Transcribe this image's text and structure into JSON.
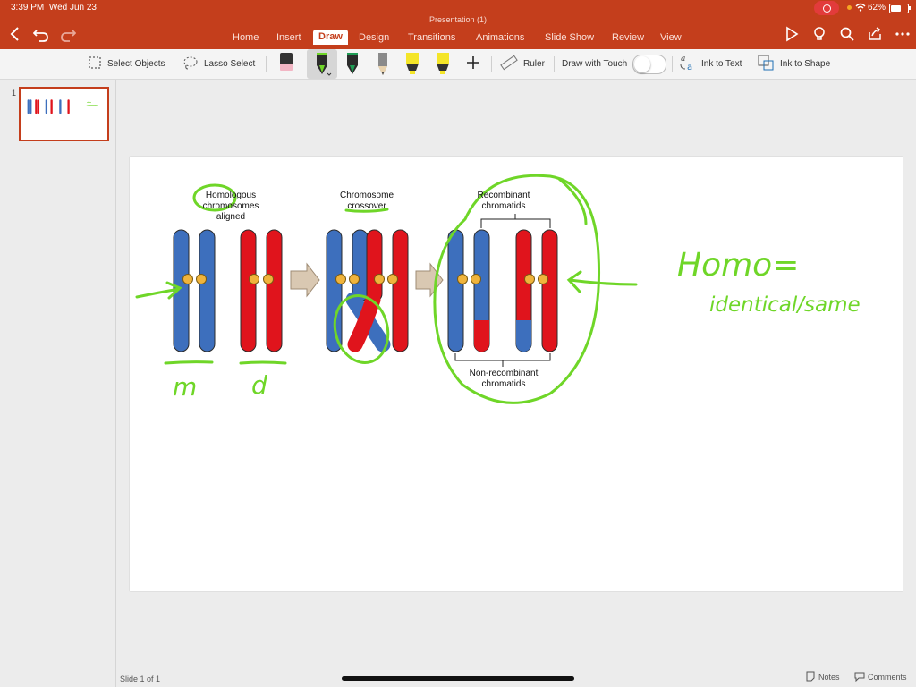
{
  "status": {
    "time": "3:39 PM",
    "date": "Wed Jun 23",
    "battery": "62%",
    "battery_level": 0.62
  },
  "document": {
    "title": "Presentation (1)"
  },
  "tabs": [
    {
      "label": "Home"
    },
    {
      "label": "Insert"
    },
    {
      "label": "Draw",
      "active": true
    },
    {
      "label": "Design"
    },
    {
      "label": "Transitions"
    },
    {
      "label": "Animations"
    },
    {
      "label": "Slide Show"
    },
    {
      "label": "Review"
    },
    {
      "label": "View"
    }
  ],
  "ribbon": {
    "select_objects": "Select Objects",
    "lasso_select": "Lasso Select",
    "ruler": "Ruler",
    "draw_with_touch": "Draw with Touch",
    "draw_with_touch_on": false,
    "ink_to_text": "Ink to Text",
    "ink_to_shape": "Ink to Shape"
  },
  "thumbnails": {
    "slide_number": "1"
  },
  "footer": {
    "slide_counter": "Slide 1 of 1",
    "notes": "Notes",
    "comments": "Comments"
  },
  "slide": {
    "label_homologous_1": "Homologous",
    "label_homologous_2": "chromosomes",
    "label_homologous_3": "aligned",
    "label_crossover_1": "Chromosome",
    "label_crossover_2": "crossover",
    "label_recombinant_1": "Recombinant",
    "label_recombinant_2": "chromatids",
    "label_nonrecombinant_1": "Non-recombinant",
    "label_nonrecombinant_2": "chromatids",
    "ink_m": "m",
    "ink_d": "d",
    "ink_homo": "Homo=",
    "ink_identical": "identical/same"
  },
  "colors": {
    "accent": "#c43e1c",
    "chromosome_blue": "#3d6fbd",
    "chromosome_red": "#e0141c",
    "centromere": "#f0b43c",
    "ink_green": "#6fd628",
    "arrow_tan": "#d9c8b2"
  }
}
